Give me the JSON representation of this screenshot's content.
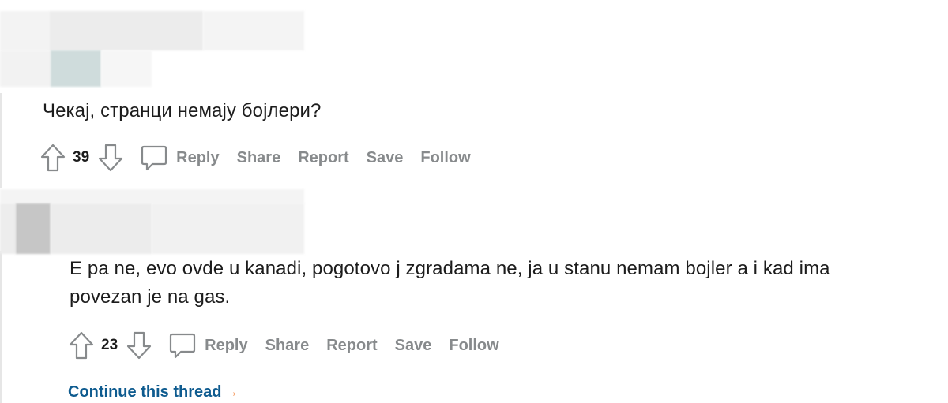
{
  "comments": [
    {
      "body": "Чекај, странци немају бојлери?",
      "votes": "39",
      "actions": {
        "reply": "Reply",
        "share": "Share",
        "report": "Report",
        "save": "Save",
        "follow": "Follow"
      }
    },
    {
      "body_line1": "E pa ne, evo ovde u kanadi, pogotovo j zgradama ne, ja u stanu nemam bojler a i kad ima",
      "body_line2": "povezan je na gas.",
      "votes": "23",
      "actions": {
        "reply": "Reply",
        "share": "Share",
        "report": "Report",
        "save": "Save",
        "follow": "Follow"
      }
    }
  ],
  "continue_thread": {
    "label": "Continue this thread",
    "arrow": "→"
  },
  "colors": {
    "text": "#1c1c1c",
    "action_gray": "#878a8c",
    "link_blue": "#0e5b8f",
    "arrow_orange": "#f6a46e",
    "thread_line": "#e6e6e6"
  },
  "icons": {
    "upvote": "upvote-arrow-icon",
    "downvote": "downvote-arrow-icon",
    "comment": "speech-bubble-icon",
    "continue": "right-arrow-icon"
  }
}
